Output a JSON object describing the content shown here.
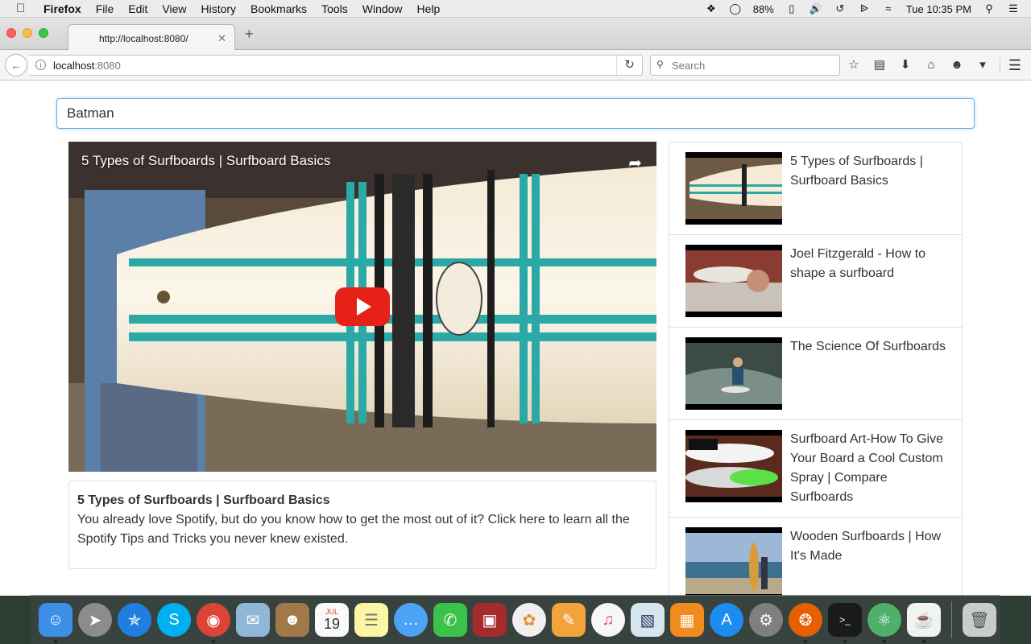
{
  "menubar": {
    "app_name": "Firefox",
    "items": [
      "File",
      "Edit",
      "View",
      "History",
      "Bookmarks",
      "Tools",
      "Window",
      "Help"
    ],
    "battery": "88%",
    "clock": "Tue 10:35 PM"
  },
  "browser": {
    "tab_title": "http://localhost:8080/",
    "url_host": "localhost",
    "url_port": ":8080",
    "search_placeholder": "Search"
  },
  "page": {
    "search_value": "Batman",
    "video": {
      "title": "5 Types of Surfboards | Surfboard Basics"
    },
    "details": {
      "title": "5 Types of Surfboards | Surfboard Basics",
      "description": "You already love Spotify, but do you know how to get the most out of it? Click here to learn all the Spotify Tips and Tricks you never knew existed."
    },
    "video_list": [
      {
        "title": "5 Types of Surfboards | Surfboard Basics"
      },
      {
        "title": "Joel Fitzgerald - How to shape a surfboard"
      },
      {
        "title": "The Science Of Surfboards"
      },
      {
        "title": "Surfboard Art-How To Give Your Board a Cool Custom Spray | Compare Surfboards"
      },
      {
        "title": "Wooden Surfboards | How It's Made"
      }
    ]
  },
  "dock": {
    "icons": [
      "finder-icon",
      "launchpad-icon",
      "safari-icon",
      "skype-icon",
      "chrome-icon",
      "mail-icon",
      "contacts-icon",
      "calendar-icon",
      "notes-icon",
      "messages-icon",
      "facetime-icon",
      "photo-booth-icon",
      "photos-icon",
      "pages-icon",
      "itunes-icon",
      "preview-icon",
      "ibooks-icon",
      "app-store-icon",
      "system-preferences-icon",
      "firefox-icon",
      "terminal-icon",
      "atom-icon",
      "java-icon",
      "trash-icon"
    ],
    "calendar_day": "19",
    "calendar_month": "JUL"
  }
}
